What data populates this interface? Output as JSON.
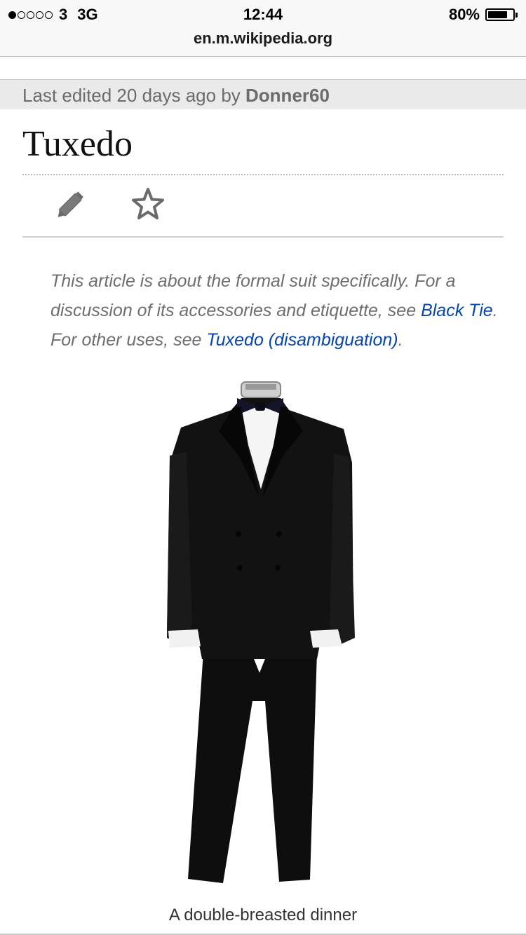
{
  "status_bar": {
    "carrier": "3",
    "network": "3G",
    "time": "12:44",
    "battery_percent": "80%",
    "battery_level": 0.8,
    "signal_bars_filled": 1,
    "signal_bars_total": 5
  },
  "browser": {
    "url": "en.m.wikipedia.org"
  },
  "edit_info": {
    "prefix": "Last edited 20 days ago by ",
    "user": "Donner60"
  },
  "article": {
    "title": "Tuxedo",
    "hatnote": {
      "part1": "This article is about the formal suit specifically. For a discussion of its accessories and etiquette, see ",
      "link1": "Black Tie",
      "part2": ". For other uses, see ",
      "link2": "Tuxedo (disambiguation)",
      "part3": "."
    },
    "image_caption": "A double-breasted dinner"
  },
  "icons": {
    "edit": "pencil-icon",
    "watch": "star-icon"
  },
  "colors": {
    "link": "#0645ad",
    "muted_text": "#6e6e6e",
    "edited_bar_bg": "#eaeaea"
  }
}
